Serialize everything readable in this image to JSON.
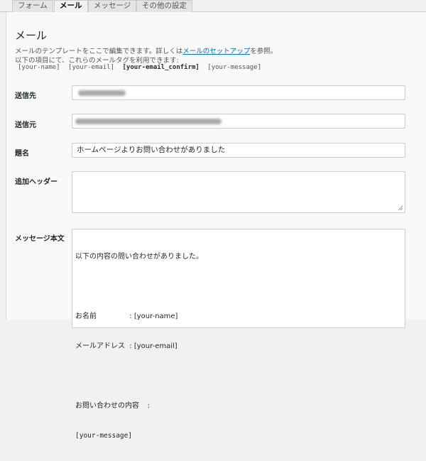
{
  "tabs": [
    {
      "label": "フォーム"
    },
    {
      "label": "メール"
    },
    {
      "label": "メッセージ"
    },
    {
      "label": "その他の設定"
    }
  ],
  "mail": {
    "title": "メール",
    "desc_prefix": "メールのテンプレートをここで編集できます。詳しくは",
    "desc_link": "メールのセットアップ",
    "desc_suffix": "を参照。",
    "desc_line2": "以下の項目にて、これらのメールタグを利用できます:",
    "tags": [
      "[your-name]",
      "[your-email]",
      "[your-email_confirm]",
      "[your-message]"
    ]
  },
  "fields": {
    "to_label": "送信先",
    "from_label": "送信元",
    "subject_label": "題名",
    "subject_value": "ホームページよりお問い合わせがありました",
    "headers_label": "追加ヘッダー",
    "body_label": "メッセージ本文",
    "body_lines": [
      "以下の内容の問い合わせがありました。",
      "",
      "お名前\t\t: [your-name]",
      "メールアドレス\t: [your-email]",
      "",
      "お問い合わせの内容\t:",
      "[your-message]"
    ]
  },
  "colors": {
    "link": "#0073aa",
    "panel": "#f9f9f9",
    "background": "#f1f1f1"
  }
}
